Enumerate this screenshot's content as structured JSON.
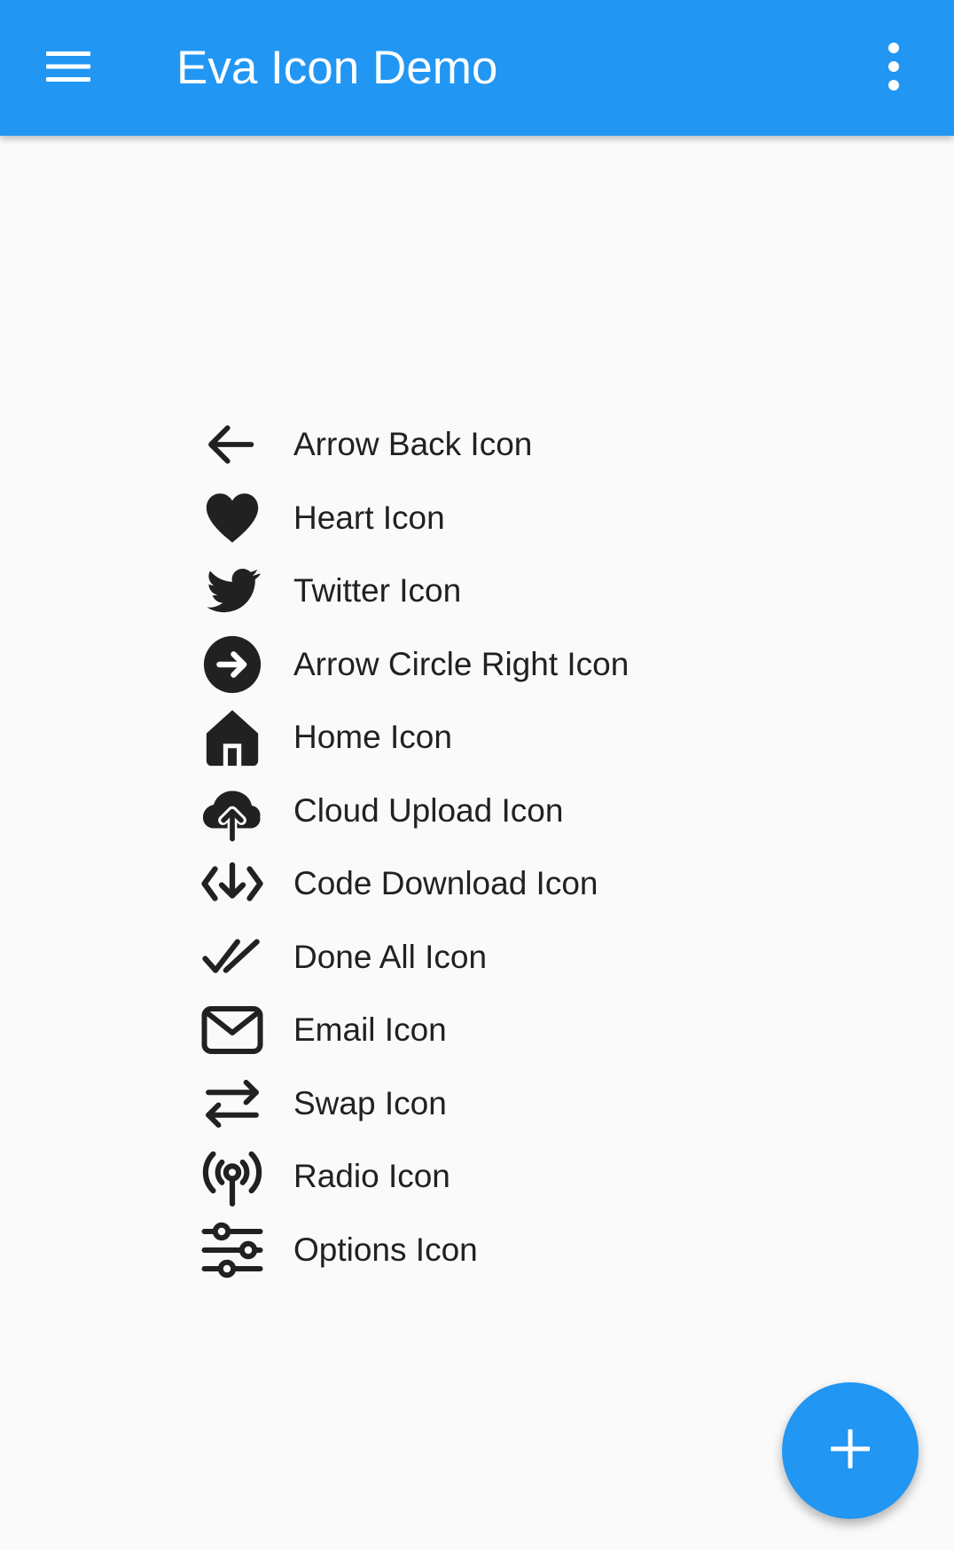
{
  "appbar": {
    "title": "Eva Icon Demo",
    "menu_icon": "menu-icon",
    "more_icon": "more-vertical-icon",
    "background_color": "#2196f3"
  },
  "icons": [
    {
      "label": "Arrow Back Icon",
      "icon": "arrow-back-icon"
    },
    {
      "label": "Heart Icon",
      "icon": "heart-icon"
    },
    {
      "label": "Twitter Icon",
      "icon": "twitter-icon"
    },
    {
      "label": "Arrow Circle Right Icon",
      "icon": "arrow-circle-right-icon"
    },
    {
      "label": "Home Icon",
      "icon": "home-icon"
    },
    {
      "label": "Cloud Upload Icon",
      "icon": "cloud-upload-icon"
    },
    {
      "label": "Code Download Icon",
      "icon": "code-download-icon"
    },
    {
      "label": "Done All Icon",
      "icon": "done-all-icon"
    },
    {
      "label": "Email Icon",
      "icon": "email-icon"
    },
    {
      "label": "Swap Icon",
      "icon": "swap-icon"
    },
    {
      "label": "Radio Icon",
      "icon": "radio-icon"
    },
    {
      "label": "Options Icon",
      "icon": "options-icon"
    }
  ],
  "fab": {
    "icon": "plus-icon",
    "color": "#2196f3"
  }
}
